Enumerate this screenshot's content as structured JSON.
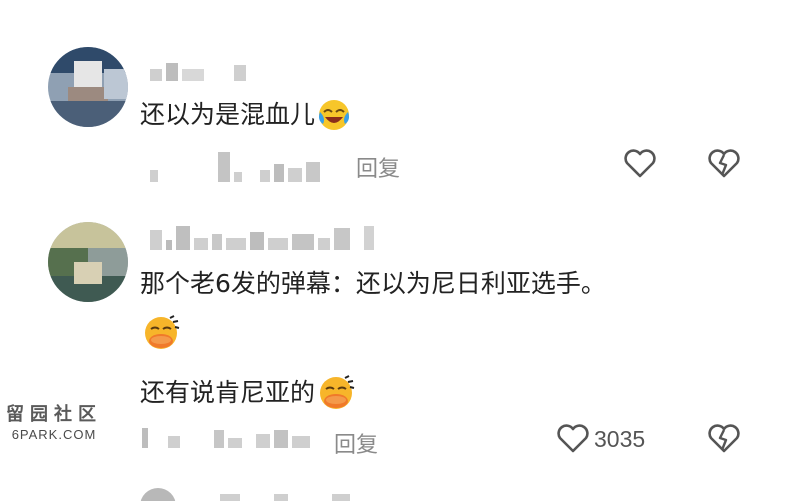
{
  "comments": [
    {
      "text": "还以为是混血儿",
      "emoji_icon": "laughing-tears-emoji",
      "reply_label": "回复",
      "like_icon": "heart-outline-icon",
      "dislike_icon": "broken-heart-icon"
    },
    {
      "text_line1": "那个老6发的弹幕：还以为尼日利亚选手。",
      "emoji_icon": "smirk-duck-emoji",
      "text_line2": "还有说肯尼亚的",
      "reply_label": "回复",
      "like_icon": "heart-outline-icon",
      "like_count": "3035",
      "dislike_icon": "broken-heart-icon"
    }
  ],
  "watermark": {
    "cn": "留园社区",
    "en": "6PARK.COM"
  }
}
